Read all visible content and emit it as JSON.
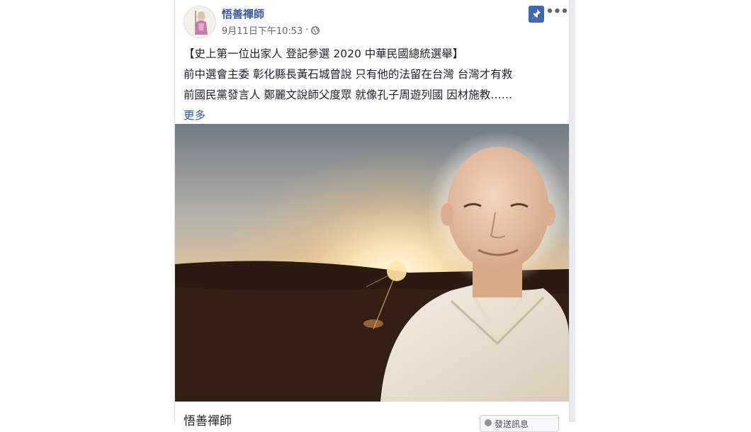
{
  "post": {
    "page_name": "悟善禪師",
    "timestamp": "9月11日下午10:53",
    "separator": "·",
    "lines": [
      "【史上第一位出家人 登記參選 2020 中華民國總統選舉】",
      "前中選會主委 彰化縣長黃石城曾說 只有他的法留在台灣 台灣才有救",
      "前國民黨發言人 鄭麗文說師父度眾 就像孔子周遊列國 因材施教……"
    ],
    "see_more": "更多"
  },
  "link_preview": {
    "name": "悟善禪師",
    "button_label": "發送訊息"
  },
  "icons": {
    "pin": "pin-icon",
    "more": "more-options-icon",
    "audience": "globe-icon"
  },
  "colors": {
    "link": "#385898",
    "pin_bg": "#4267b2",
    "meta": "#616770"
  }
}
